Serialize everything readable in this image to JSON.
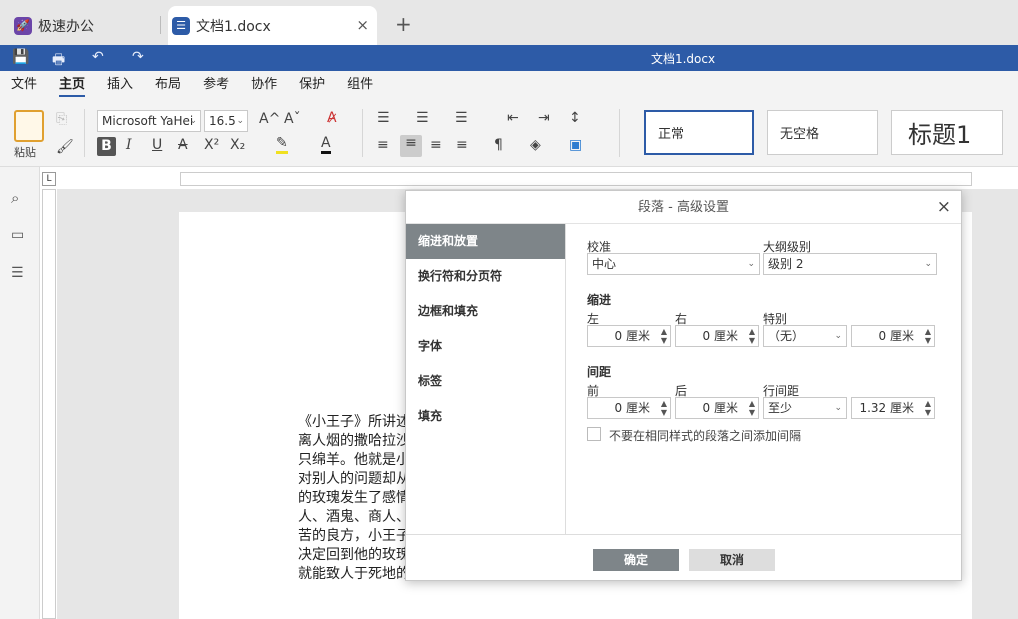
{
  "tabs": {
    "app_label": "极速办公",
    "doc_label": "文档1.docx",
    "close_glyph": "×",
    "add_glyph": "+"
  },
  "titlebar": {
    "document_title": "文档1.docx"
  },
  "menu": {
    "items": [
      "文件",
      "主页",
      "插入",
      "布局",
      "参考",
      "协作",
      "保护",
      "组件"
    ],
    "active": "主页"
  },
  "ribbon": {
    "paste_label": "粘贴",
    "font_name": "Microsoft YaHei",
    "font_size": "16.5",
    "styles": [
      "正常",
      "无空格",
      "标题1"
    ]
  },
  "document": {
    "lines": [
      "《小王子》所讲述",
      "离人烟的撒哈拉沙",
      "只绵羊。他就是小",
      "对别人的问题却从",
      "的玫瑰发生了感情",
      "人、酒鬼、商人、",
      "苦的良方，小王子",
      "决定回到他的玫瑰",
      "就能致人于死地的"
    ]
  },
  "dialog": {
    "title": "段落 - 高级设置",
    "close_glyph": "×",
    "nav_items": [
      "缩进和放置",
      "换行符和分页符",
      "边框和填充",
      "字体",
      "标签",
      "填充"
    ],
    "active_nav": "缩进和放置",
    "alignment_label": "校准",
    "alignment_value": "中心",
    "outline_label": "大纲级别",
    "outline_value": "级别 2",
    "indent_section": "缩进",
    "left_label": "左",
    "left_value": "0 厘米",
    "right_label": "右",
    "right_value": "0 厘米",
    "special_label": "特别",
    "special_value": "（无）",
    "special_amount": "0 厘米",
    "spacing_section": "间距",
    "before_label": "前",
    "before_value": "0 厘米",
    "after_label": "后",
    "after_value": "0 厘米",
    "line_spacing_label": "行间距",
    "line_spacing_value": "至少",
    "line_spacing_amount": "1.32 厘米",
    "checkbox_label": "不要在相同样式的段落之间添加间隔",
    "ok_label": "确定",
    "cancel_label": "取消"
  },
  "colors": {
    "accent": "#2d5ba7",
    "nav_active": "#7e8589",
    "ok_button": "#7e8589",
    "cancel_button": "#dddddd"
  }
}
